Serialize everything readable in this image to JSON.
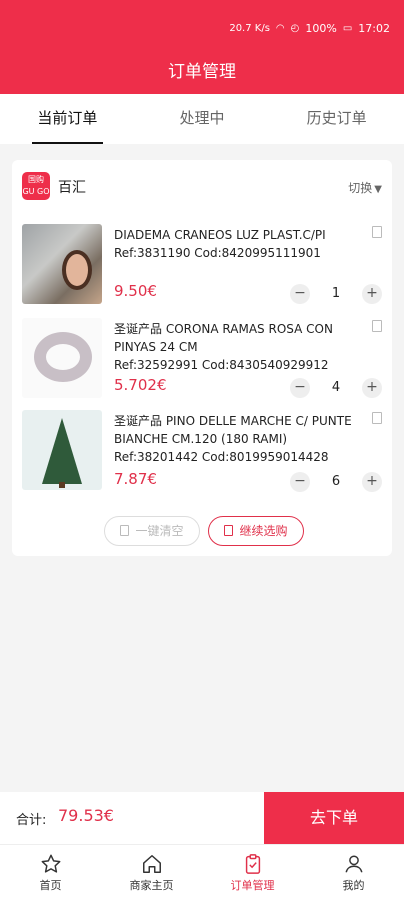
{
  "status_bar": {
    "battery": "100%",
    "time": "17:02",
    "speed": "20.7 K/s"
  },
  "header": {
    "title": "订单管理"
  },
  "tabs": [
    {
      "label": "当前订单"
    },
    {
      "label": "处理中"
    },
    {
      "label": "历史订单"
    }
  ],
  "store": {
    "name": "百汇",
    "switch_label": "切换",
    "logo_line1": "国购",
    "logo_line2": "GU GO"
  },
  "items": [
    {
      "name": "DIADEMA CRANEOS LUZ PLAST.C/PI",
      "ref_line": "Ref:3831190 Cod:8420995111901",
      "price": "9.50€",
      "quantity": "1"
    },
    {
      "name": "圣诞产品 CORONA RAMAS ROSA CON PINYAS 24 CM",
      "ref_line": "Ref:32592991 Cod:8430540929912",
      "price": "5.702€",
      "quantity": "4"
    },
    {
      "name": "圣诞产品 PINO DELLE MARCHE C/ PUNTE BIANCHE CM.120 (180 RAMI)",
      "ref_line": "Ref:38201442 Cod:8019959014428",
      "price": "7.87€",
      "quantity": "6"
    }
  ],
  "actions": {
    "clear_label": "一键清空",
    "continue_label": "继续选购"
  },
  "summary": {
    "total_label": "合计:",
    "total_value": "79.53€",
    "checkout_label": "去下单"
  },
  "tabbar": [
    {
      "label": "首页",
      "icon": "star-icon"
    },
    {
      "label": "商家主页",
      "icon": "home-icon"
    },
    {
      "label": "订单管理",
      "icon": "clipboard-check-icon"
    },
    {
      "label": "我的",
      "icon": "user-icon"
    }
  ],
  "colors": {
    "primary": "#ee2e4a",
    "price": "#e0304a"
  }
}
